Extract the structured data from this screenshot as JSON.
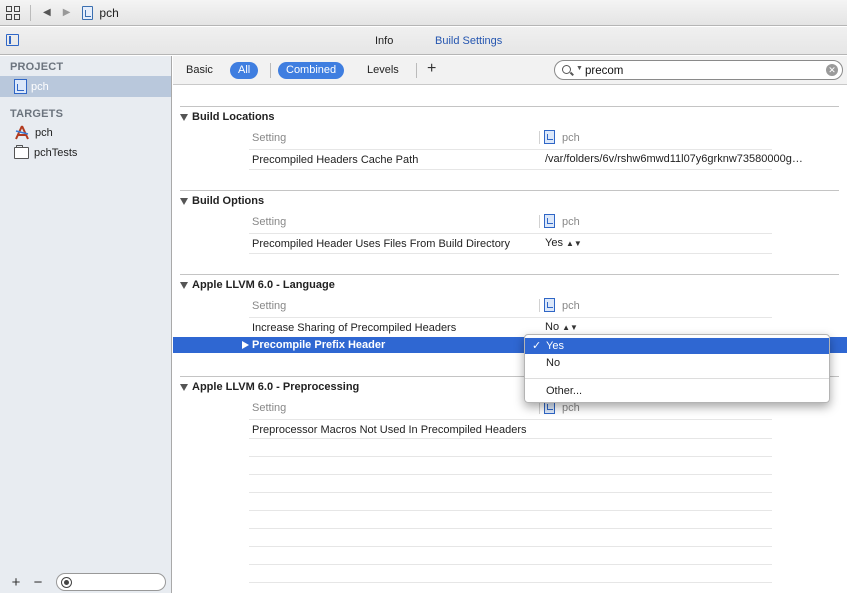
{
  "jumpbar": {
    "title": "pch"
  },
  "tabs": {
    "info": "Info",
    "build_settings": "Build Settings"
  },
  "sidebar": {
    "project_header": "PROJECT",
    "project_item": "pch",
    "targets_header": "TARGETS",
    "targets": [
      "pch",
      "pchTests"
    ],
    "add_label": "+",
    "remove_label": "−"
  },
  "toolbar": {
    "basic": "Basic",
    "all": "All",
    "combined": "Combined",
    "levels": "Levels",
    "add": "+"
  },
  "search": {
    "value": "precom"
  },
  "columns": {
    "setting": "Setting",
    "target": "pch"
  },
  "sections": [
    {
      "title": "Build Locations",
      "rows": [
        {
          "name": "Precompiled Headers Cache Path",
          "value": "/var/folders/6v/rshw6mwd11l07y6grknw73580000g…"
        }
      ]
    },
    {
      "title": "Build Options",
      "rows": [
        {
          "name": "Precompiled Header Uses Files From Build Directory",
          "value": "Yes"
        }
      ]
    },
    {
      "title": "Apple LLVM 6.0 - Language",
      "rows": [
        {
          "name": "Increase Sharing of Precompiled Headers",
          "value": "No"
        },
        {
          "name": "Precompile Prefix Header",
          "value": "Yes"
        }
      ]
    },
    {
      "title": "Apple LLVM 6.0 - Preprocessing",
      "rows": [
        {
          "name": "Preprocessor Macros Not Used In Precompiled Headers",
          "value": ""
        }
      ]
    }
  ],
  "popup": {
    "options": [
      "Yes",
      "No",
      "Other..."
    ],
    "selected": "Yes",
    "check": "✓"
  }
}
